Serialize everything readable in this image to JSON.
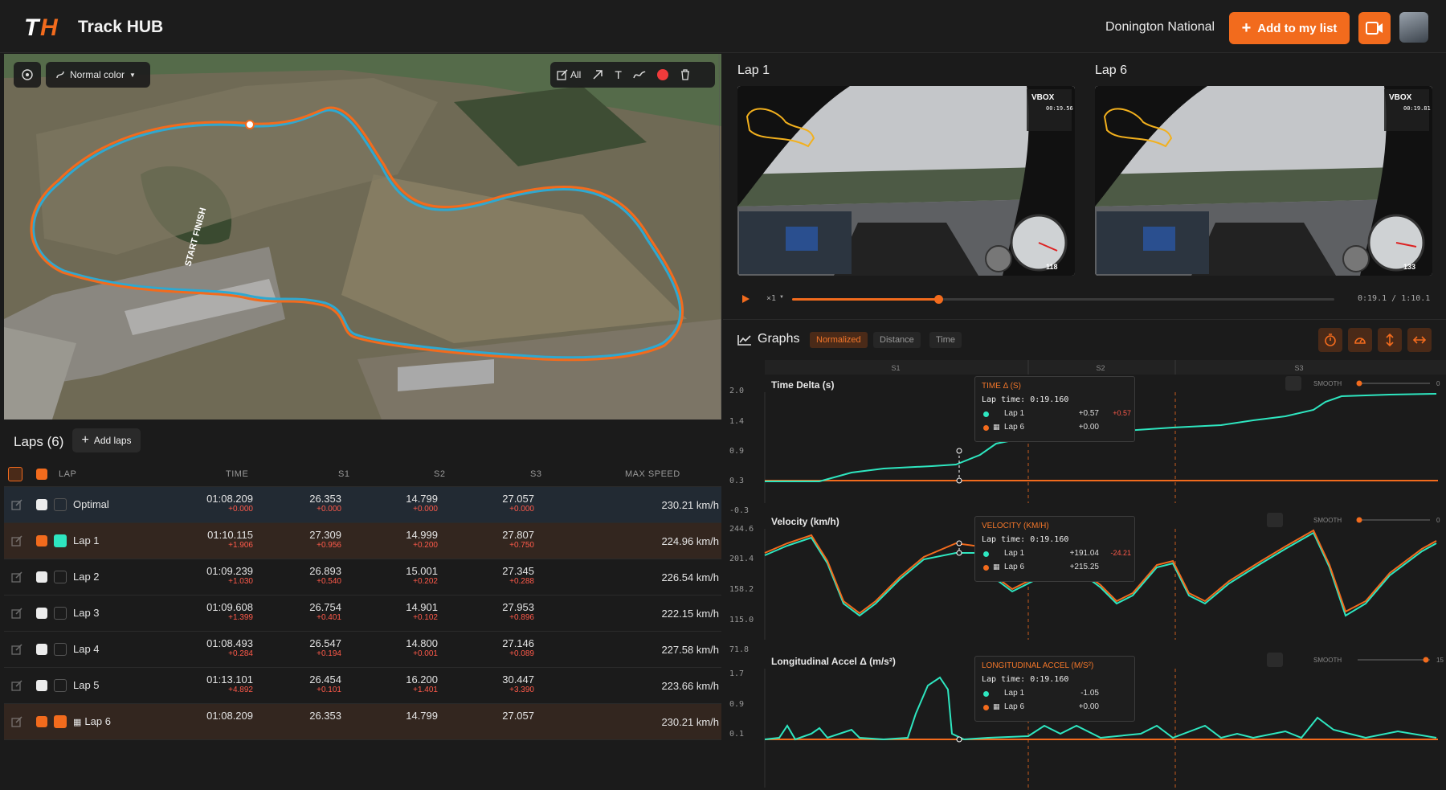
{
  "header": {
    "logo_text": "TH",
    "app_title": "Track HUB",
    "track_name": "Donington National",
    "add_list_label": "Add to my list",
    "icons": {
      "add": "plus-icon",
      "video": "video-icon",
      "avatar": "car-avatar"
    }
  },
  "map": {
    "color_mode": "Normal color",
    "draw_all_label": "All",
    "start_finish": "START FINISH",
    "tools": [
      "locate-icon",
      "edit-all-icon",
      "arrow-icon",
      "text-icon",
      "freehand-icon",
      "record-dot-icon",
      "trash-icon"
    ]
  },
  "laps": {
    "title": "Laps (6)",
    "add_label": "Add laps",
    "columns": {
      "lap": "LAP",
      "time": "TIME",
      "s1": "S1",
      "s2": "S2",
      "s3": "S3",
      "max_speed": "MAX SPEED"
    },
    "rows": [
      {
        "name": "Optimal",
        "checked": false,
        "color": "",
        "time": "01:08.209",
        "time_d": "+0.000",
        "s1": "26.353",
        "s1_d": "+0.000",
        "s2": "14.799",
        "s2_d": "+0.000",
        "s3": "27.057",
        "s3_d": "+0.000",
        "max": "230.21 km/h"
      },
      {
        "name": "Lap 1",
        "checked": true,
        "color": "#2ee6c0",
        "time": "01:10.115",
        "time_d": "+1.906",
        "s1": "27.309",
        "s1_d": "+0.956",
        "s2": "14.999",
        "s2_d": "+0.200",
        "s3": "27.807",
        "s3_d": "+0.750",
        "max": "224.96 km/h"
      },
      {
        "name": "Lap 2",
        "checked": false,
        "color": "",
        "time": "01:09.239",
        "time_d": "+1.030",
        "s1": "26.893",
        "s1_d": "+0.540",
        "s2": "15.001",
        "s2_d": "+0.202",
        "s3": "27.345",
        "s3_d": "+0.288",
        "max": "226.54 km/h"
      },
      {
        "name": "Lap 3",
        "checked": false,
        "color": "",
        "time": "01:09.608",
        "time_d": "+1.399",
        "s1": "26.754",
        "s1_d": "+0.401",
        "s2": "14.901",
        "s2_d": "+0.102",
        "s3": "27.953",
        "s3_d": "+0.896",
        "max": "222.15 km/h"
      },
      {
        "name": "Lap 4",
        "checked": false,
        "color": "",
        "time": "01:08.493",
        "time_d": "+0.284",
        "s1": "26.547",
        "s1_d": "+0.194",
        "s2": "14.800",
        "s2_d": "+0.001",
        "s3": "27.146",
        "s3_d": "+0.089",
        "max": "227.58 km/h"
      },
      {
        "name": "Lap 5",
        "checked": false,
        "color": "",
        "time": "01:13.101",
        "time_d": "+4.892",
        "s1": "26.454",
        "s1_d": "+0.101",
        "s2": "16.200",
        "s2_d": "+1.401",
        "s3": "30.447",
        "s3_d": "+3.390",
        "max": "223.66 km/h"
      },
      {
        "name": "Lap 6",
        "checked": true,
        "color": "#f26b1d",
        "time": "01:08.209",
        "time_d": "",
        "s1": "26.353",
        "s1_d": "",
        "s2": "14.799",
        "s2_d": "",
        "s3": "27.057",
        "s3_d": "",
        "max": "230.21 km/h"
      }
    ]
  },
  "videos": {
    "left_label": "Lap 1",
    "right_label": "Lap 6",
    "left_overlay_speed": "118",
    "right_overlay_speed": "133",
    "brand": "VBOX",
    "left_timer": "00:19.56",
    "right_timer": "00:19.81",
    "speed_rate": "×1",
    "position": "0:19.1",
    "duration": "1:10.1",
    "progress": 0.27
  },
  "graphs": {
    "title": "Graphs",
    "modes": [
      "Normalized",
      "Distance",
      "Time"
    ],
    "active_mode": "Normalized",
    "sectors": [
      "S1",
      "S2",
      "S3"
    ],
    "smooth_label": "SMOOTH",
    "panels": [
      {
        "title": "Time Delta (s)",
        "yticks": [
          "2.0",
          "1.4",
          "0.9",
          "0.3",
          "-0.3"
        ],
        "smooth_value": "0"
      },
      {
        "title": "Velocity (km/h)",
        "yticks": [
          "244.6",
          "201.4",
          "158.2",
          "115.0",
          "71.8"
        ],
        "smooth_value": "0"
      },
      {
        "title": "Longitudinal Accel Δ (m/s²)",
        "yticks": [
          "1.7",
          "0.9",
          "0.1"
        ],
        "smooth_value": "15"
      }
    ],
    "tooltips": [
      {
        "title": "TIME Δ (S)",
        "time": "Lap time: 0:19.160",
        "lap1": "Lap 1",
        "lap1_val": "+0.57",
        "lap1_delta": "+0.57",
        "lap6": "Lap 6",
        "lap6_val": "+0.00"
      },
      {
        "title": "VELOCITY (KM/H)",
        "time": "Lap time: 0:19.160",
        "lap1": "Lap 1",
        "lap1_val": "+191.04",
        "lap1_delta": "-24.21",
        "lap6": "Lap 6",
        "lap6_val": "+215.25"
      },
      {
        "title": "LONGITUDINAL ACCEL (M/S²)",
        "time": "Lap time: 0:19.160",
        "lap1": "Lap 1",
        "lap1_val": "-1.05",
        "lap1_delta": "",
        "lap6": "Lap 6",
        "lap6_val": "+0.00"
      }
    ],
    "colors": {
      "lap1": "#2ee6c0",
      "lap6": "#f26b1d"
    }
  }
}
